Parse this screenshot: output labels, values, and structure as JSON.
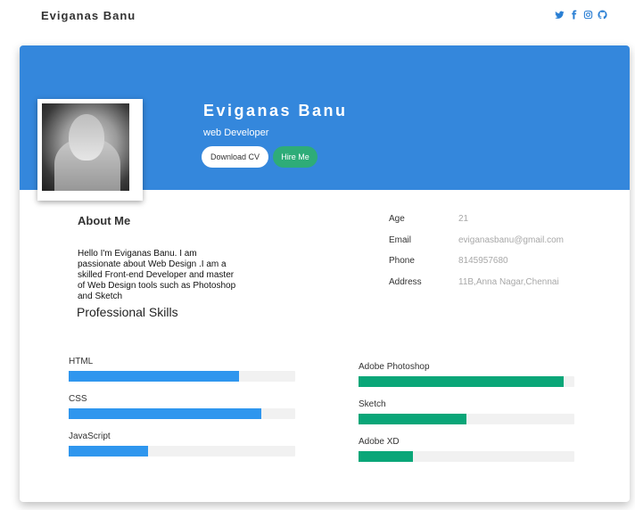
{
  "nav": {
    "brand": "Eviganas Banu",
    "social_icons": [
      "twitter-icon",
      "facebook-icon",
      "instagram-icon",
      "github-icon"
    ],
    "icon_color": "#2a7fd4"
  },
  "profile": {
    "name": "Eviganas Banu",
    "role": "web Developer",
    "download_label": "Download CV",
    "hire_label": "Hire Me",
    "banner_color": "#3487dc",
    "hire_color": "#2eac78"
  },
  "about": {
    "title": "About Me",
    "text": "Hello I'm Eviganas Banu. I am passionate about Web Design .I am a skilled Front-end Developer and master of Web Design tools such as Photoshop and Sketch"
  },
  "info": [
    {
      "label": "Age",
      "value": "21"
    },
    {
      "label": "Email",
      "value": "eviganasbanu@gmail.com"
    },
    {
      "label": "Phone",
      "value": "8145957680"
    },
    {
      "label": "Address",
      "value": "11B,Anna Nagar,Chennai"
    }
  ],
  "skills": {
    "title": "Professional Skills",
    "left": [
      {
        "name": "HTML",
        "level": 0.75
      },
      {
        "name": "CSS",
        "level": 0.85
      },
      {
        "name": "JavaScript",
        "level": 0.35
      }
    ],
    "right": [
      {
        "name": "Adobe Photoshop",
        "level": 0.95
      },
      {
        "name": "Sketch",
        "level": 0.5
      },
      {
        "name": "Adobe XD",
        "level": 0.25
      }
    ],
    "left_color": "#2f96ee",
    "right_color": "#0aa678"
  }
}
